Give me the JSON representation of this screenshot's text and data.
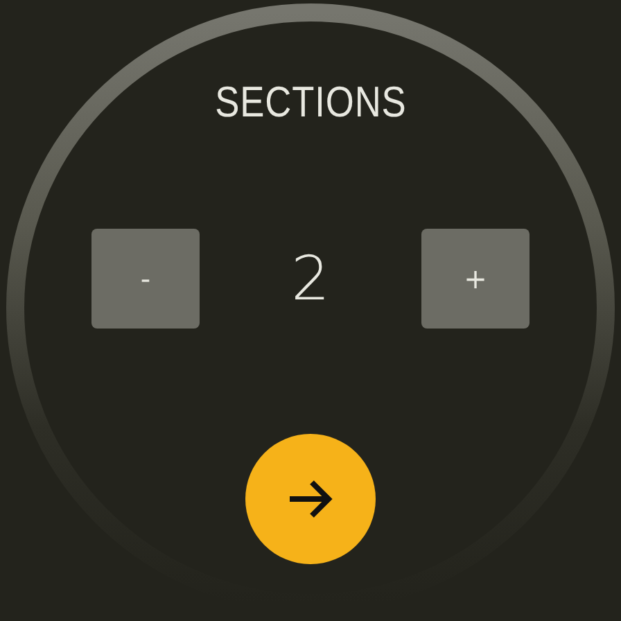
{
  "title": "SECTIONS",
  "stepper": {
    "decrement": "-",
    "value": "2",
    "increment": "+"
  },
  "next_button": {
    "kind": "arrow"
  }
}
